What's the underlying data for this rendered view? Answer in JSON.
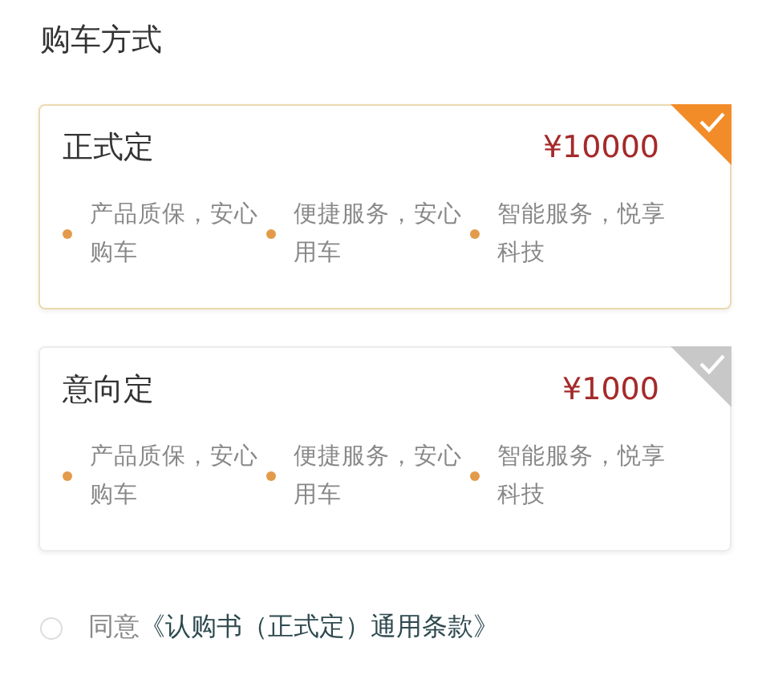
{
  "section_title": "购车方式",
  "options": [
    {
      "name": "正式定",
      "price": "¥10000",
      "selected": true,
      "features": [
        "产品质保，安心购车",
        "便捷服务，安心用车",
        "智能服务，悦享科技"
      ]
    },
    {
      "name": "意向定",
      "price": "¥1000",
      "selected": false,
      "features": [
        "产品质保，安心购车",
        "便捷服务，安心用车",
        "智能服务，悦享科技"
      ]
    }
  ],
  "agreement": {
    "checked": false,
    "prefix": "同意",
    "link": "《认购书（正式定）通用条款》"
  }
}
